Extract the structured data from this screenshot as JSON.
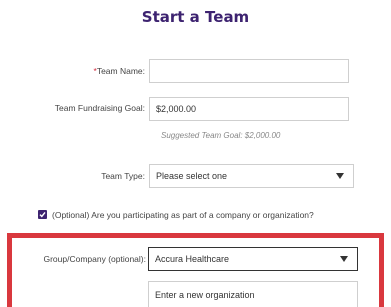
{
  "form": {
    "title": "Start a Team",
    "team_name": {
      "required_mark": "*",
      "label": "Team Name:",
      "value": ""
    },
    "fundraising_goal": {
      "label": "Team Fundraising Goal:",
      "value": "$2,000.00",
      "suggestion": "Suggested Team Goal: $2,000.00"
    },
    "team_type": {
      "label": "Team Type:",
      "selected": "Please select one"
    },
    "company_checkbox": {
      "checked": true,
      "label": "(Optional) Are you participating as part of a company or organization?"
    },
    "group_company": {
      "label": "Group/Company (optional):",
      "selected": "Accura Healthcare",
      "new_org_placeholder": "Enter a new organization"
    }
  },
  "colors": {
    "title": "#3d2370",
    "required": "#d2283c",
    "highlight_border": "#d9383e",
    "checkbox": "#3d2370"
  }
}
